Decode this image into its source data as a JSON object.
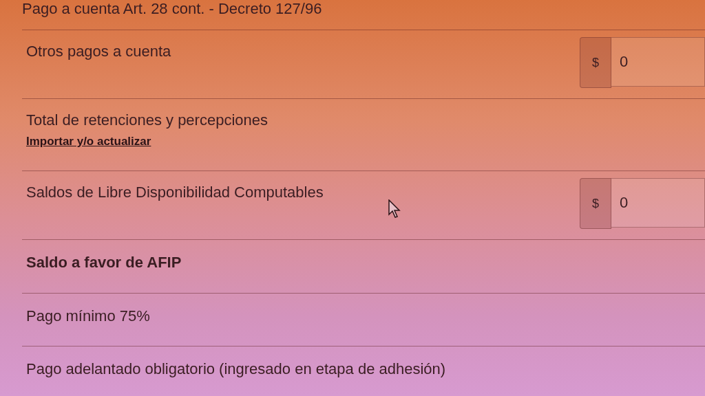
{
  "rows": [
    {
      "kind": "plain",
      "label": "Pago a cuenta Art. 28 cont. - Decreto 127/96"
    },
    {
      "kind": "amount",
      "label": "Otros pagos a cuenta",
      "prefix": "$",
      "value": "0"
    },
    {
      "kind": "link",
      "label": "Total de retenciones y percepciones",
      "link": "Importar y/o actualizar"
    },
    {
      "kind": "amount",
      "label": "Saldos de Libre Disponibilidad Computables",
      "prefix": "$",
      "value": "0"
    },
    {
      "kind": "heading",
      "label": "Saldo a favor de AFIP"
    },
    {
      "kind": "plain",
      "label": "Pago mínimo 75%"
    },
    {
      "kind": "plain",
      "label": "Pago adelantado obligatorio (ingresado en etapa de adhesión)"
    }
  ]
}
